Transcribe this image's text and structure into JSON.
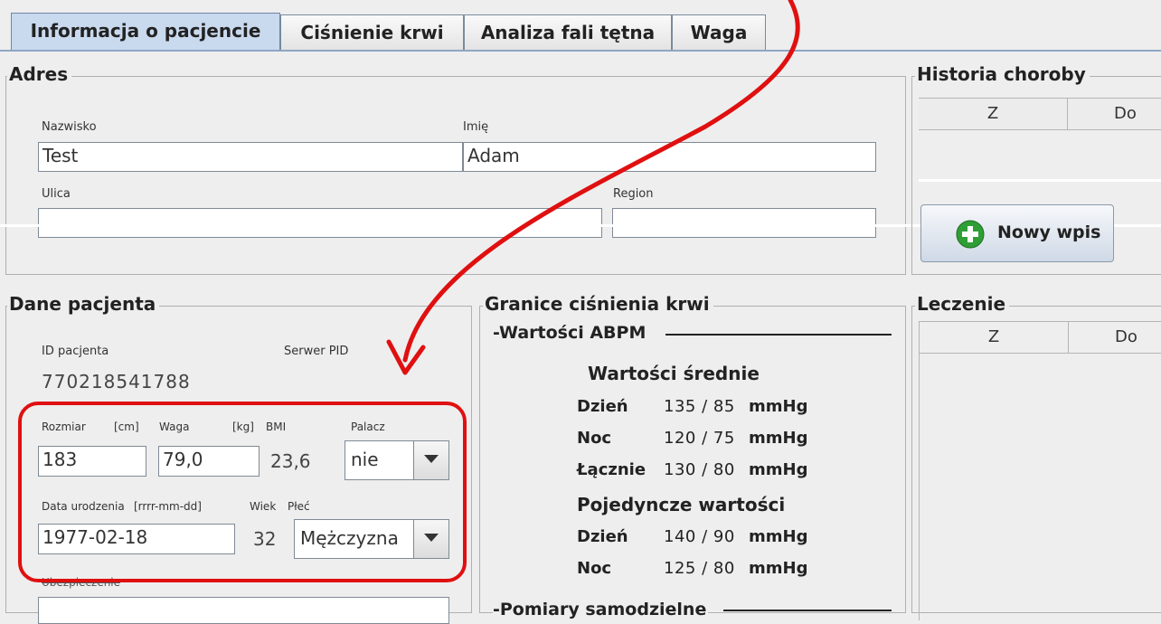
{
  "tabs": [
    {
      "label": "Informacja o pacjencie"
    },
    {
      "label": "Ciśnienie krwi"
    },
    {
      "label": "Analiza fali tętna"
    },
    {
      "label": "Waga"
    }
  ],
  "address": {
    "title": "Adres",
    "surname_label": "Nazwisko",
    "surname_value": "Test",
    "firstname_label": "Imię",
    "firstname_value": "Adam",
    "street_label": "Ulica",
    "street_value": "",
    "region_label": "Region",
    "region_value": ""
  },
  "history": {
    "title": "Historia choroby",
    "col_from": "Z",
    "col_to": "Do",
    "new_entry": "Nowy wpis"
  },
  "patient": {
    "title": "Dane pacjenta",
    "id_label": "ID pacjenta",
    "server_label": "Serwer PID",
    "id_value": "770218541788",
    "size_label": "Rozmiar",
    "size_unit": "[cm]",
    "weight_label": "Waga",
    "weight_unit": "[kg]",
    "bmi_label": "BMI",
    "smoker_label": "Palacz",
    "size_value": "183",
    "weight_value": "79,0",
    "bmi_value": "23,6",
    "smoker_value": "nie",
    "dob_label": "Data urodzenia",
    "dob_format": "[rrrr-mm-dd]",
    "age_label": "Wiek",
    "sex_label": "Płeć",
    "dob_value": "1977-02-18",
    "age_value": "32",
    "sex_value": "Mężczyzna",
    "insurance_label": "Ubezpieczenie",
    "insurance_value": ""
  },
  "bp_limits": {
    "title": "Granice ciśnienia krwi",
    "abpm_title": "-Wartości ABPM",
    "avg_title": "Wartości średnie",
    "avg_rows": [
      {
        "label": "Dzień",
        "value": "135 / 85",
        "unit": "mmHg"
      },
      {
        "label": "Noc",
        "value": "120 / 75",
        "unit": "mmHg"
      },
      {
        "label": "Łącznie",
        "value": "130 / 80",
        "unit": "mmHg"
      }
    ],
    "single_title": "Pojedyncze wartości",
    "single_rows": [
      {
        "label": "Dzień",
        "value": "140 / 90",
        "unit": "mmHg"
      },
      {
        "label": "Noc",
        "value": "125 / 80",
        "unit": "mmHg"
      }
    ],
    "self_title": "-Pomiary samodzielne"
  },
  "treatment": {
    "title": "Leczenie",
    "col_from": "Z",
    "col_to": "Do"
  },
  "colors": {
    "highlight": "#e01010",
    "accent": "#c9d9ee",
    "plus": "#2f9e35"
  }
}
